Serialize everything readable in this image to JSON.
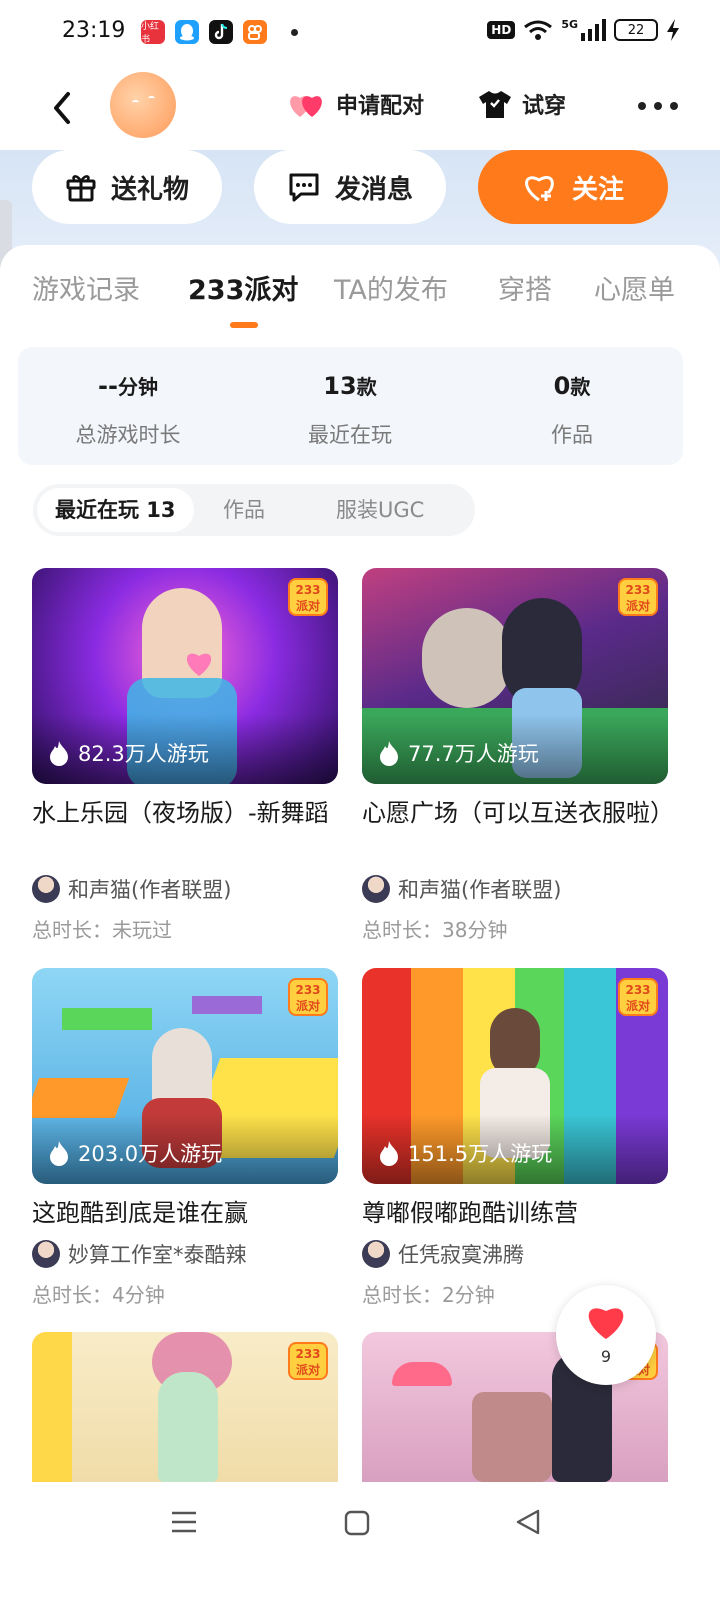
{
  "status": {
    "time": "23:19",
    "app1_label": "小红书",
    "hd": "HD",
    "signal": "5G",
    "battery": "22"
  },
  "nav": {
    "match_label": "申请配对",
    "tryon_label": "试穿"
  },
  "actions": {
    "gift_label": "送礼物",
    "message_label": "发消息",
    "follow_label": "关注"
  },
  "tabs": [
    {
      "label": "游戏记录"
    },
    {
      "label": "233派对"
    },
    {
      "label": "TA的发布"
    },
    {
      "label": "穿搭"
    },
    {
      "label": "心愿单"
    }
  ],
  "stats": [
    {
      "value": "--",
      "unit": "分钟",
      "label": "总游戏时长"
    },
    {
      "value": "13",
      "unit": "款",
      "label": "最近在玩"
    },
    {
      "value": "0",
      "unit": "款",
      "label": "作品"
    }
  ],
  "subtabs": {
    "recent": "最近在玩 13",
    "works": "作品",
    "ugc": "服装UGC"
  },
  "games": [
    {
      "badge_top": "233",
      "badge_bottom": "派对",
      "plays": "82.3万人游玩",
      "title": "水上乐园（夜场版）-新舞蹈",
      "author": "和声猫(作者联盟)",
      "duration": "总时长：未玩过",
      "theme_color": "#8a2be2"
    },
    {
      "badge_top": "233",
      "badge_bottom": "派对",
      "plays": "77.7万人游玩",
      "title": "心愿广场（可以互送衣服啦）",
      "author": "和声猫(作者联盟)",
      "duration": "总时长：38分钟",
      "theme_color": "#6a3aa8"
    },
    {
      "badge_top": "233",
      "badge_bottom": "派对",
      "plays": "203.0万人游玩",
      "title": "这跑酷到底是谁在赢",
      "author": "妙算工作室*泰酷辣",
      "duration": "总时长：4分钟",
      "theme_color": "#3aa0e8"
    },
    {
      "badge_top": "233",
      "badge_bottom": "派对",
      "plays": "151.5万人游玩",
      "title": "尊嘟假嘟跑酷训练营",
      "author": "任凭寂寞沸腾",
      "duration": "总时长：2分钟",
      "theme_color": "#e8322a"
    },
    {
      "badge_top": "233",
      "badge_bottom": "派对",
      "theme_color": "#f3e3b8"
    },
    {
      "badge_top": "233",
      "badge_bottom": "派对",
      "theme_color": "#e6b3d0"
    }
  ],
  "like": {
    "count": "9"
  },
  "colors": {
    "accent": "#ff7a1a",
    "heart": "#ff3b4a"
  }
}
